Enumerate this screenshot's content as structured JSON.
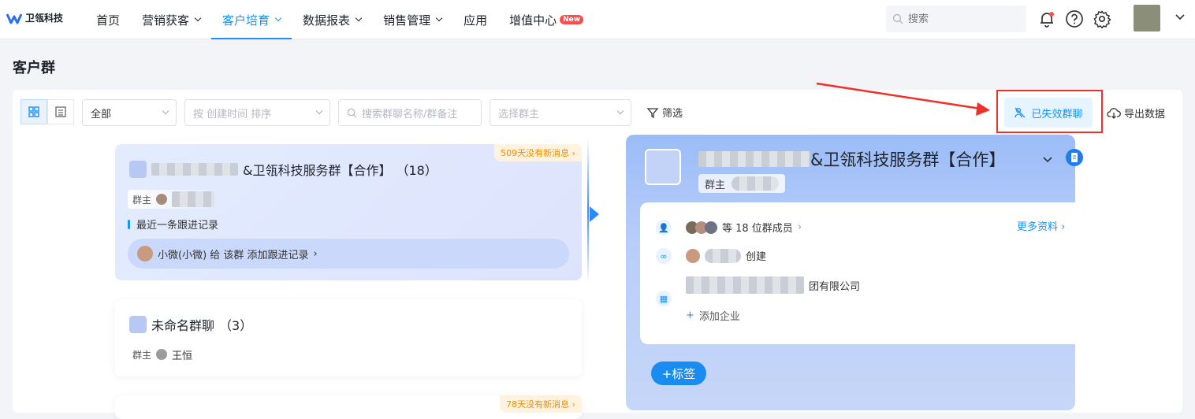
{
  "app": {
    "logo_text": "卫瓴科技"
  },
  "nav": {
    "items": [
      {
        "label": "首页"
      },
      {
        "label": "营销获客"
      },
      {
        "label": "客户培育"
      },
      {
        "label": "数据报表"
      },
      {
        "label": "销售管理"
      },
      {
        "label": "应用"
      },
      {
        "label": "增值中心"
      }
    ],
    "new_badge": "New",
    "active_index": 2
  },
  "search": {
    "placeholder": "搜索"
  },
  "page": {
    "title": "客户群"
  },
  "toolbar": {
    "scope_select": "全部",
    "sort_select_placeholder": "按 创建时间 排序",
    "search_placeholder": "搜索群聊名称/群备注",
    "owner_select_placeholder": "选择群主",
    "filter_label": "筛选",
    "expired_groups_label": "已失效群聊",
    "export_label": "导出数据"
  },
  "groups": [
    {
      "name": "&卫瓴科技服务群【合作】",
      "count": "（18）",
      "owner_label": "群主",
      "stale_badge": "509天没有新消息",
      "last_follow_label": "最近一条跟进记录",
      "follow_text": "小微(小微) 给 该群 添加跟进记录"
    },
    {
      "name": "未命名群聊",
      "count": "（3）",
      "owner_label": "群主",
      "owner_name": "王恒"
    },
    {
      "stale_badge": "78天没有新消息"
    }
  ],
  "detail": {
    "title": "&卫瓴科技服务群【合作】",
    "owner_label": "群主",
    "members_text": "等 18 位群成员",
    "more_info": "更多资料",
    "creator_suffix": "创建",
    "company_suffix": "团有限公司",
    "add_company": "添加企业",
    "tag_button": "+标签"
  },
  "colors": {
    "accent": "#1890ff",
    "annotation": "#f0302a",
    "stale": "#f08c00"
  }
}
